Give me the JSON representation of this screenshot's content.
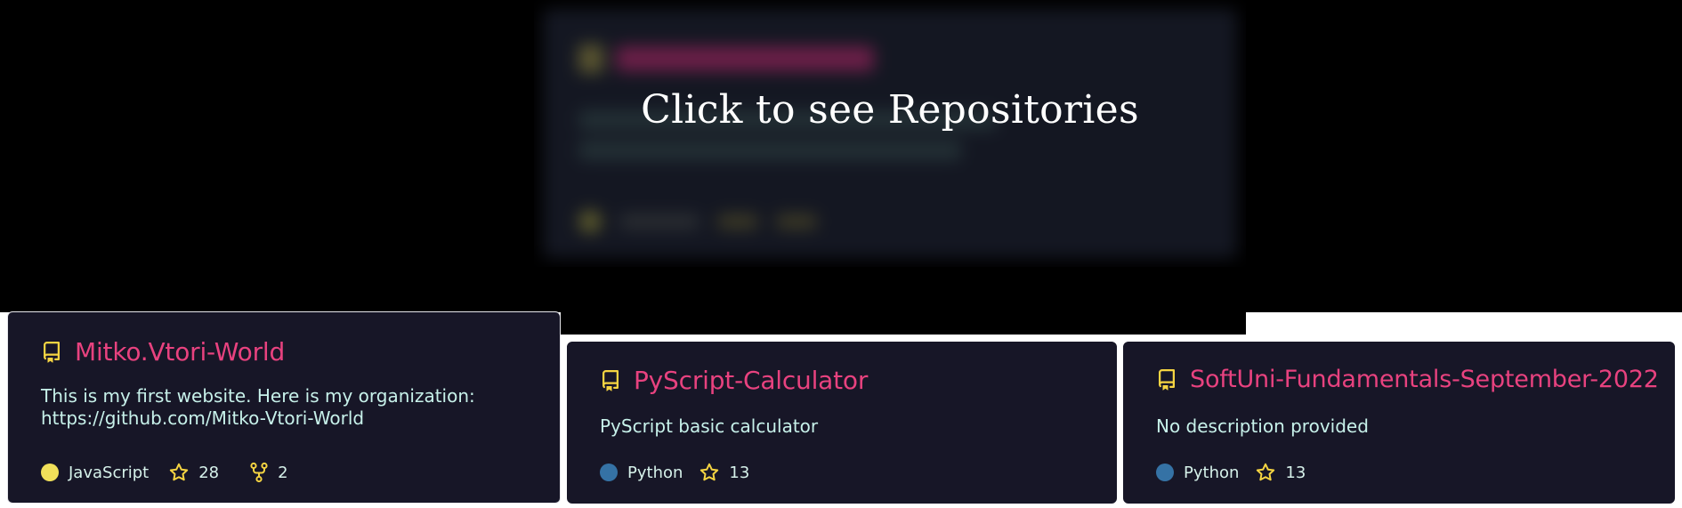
{
  "preview": {
    "caption": "Click to see Repositories"
  },
  "repos": [
    {
      "name": "Mitko.Vtori-World",
      "description_lines": [
        "This is my first website. Here is my organization:",
        "https://github.com/Mitko-Vtori-World"
      ],
      "language": "JavaScript",
      "language_color": "#f1e05a",
      "stars": "28",
      "forks": "2"
    },
    {
      "name": "PyScript-Calculator",
      "description_lines": [
        "PyScript basic calculator"
      ],
      "language": "Python",
      "language_color": "#3572a5",
      "stars": "13"
    },
    {
      "name": "SoftUni-Fundamentals-September-2022",
      "description_lines": [
        "No description provided"
      ],
      "language": "Python",
      "language_color": "#3572a5",
      "stars": "13"
    }
  ],
  "colors": {
    "page_background": "#000000",
    "card_background": "#171627",
    "repo_name": "#e8427f",
    "icon": "#f5d442",
    "description": "#c5f1ea"
  },
  "icons": {
    "repo": "repo-book-icon",
    "star": "star-icon",
    "fork": "fork-icon"
  }
}
